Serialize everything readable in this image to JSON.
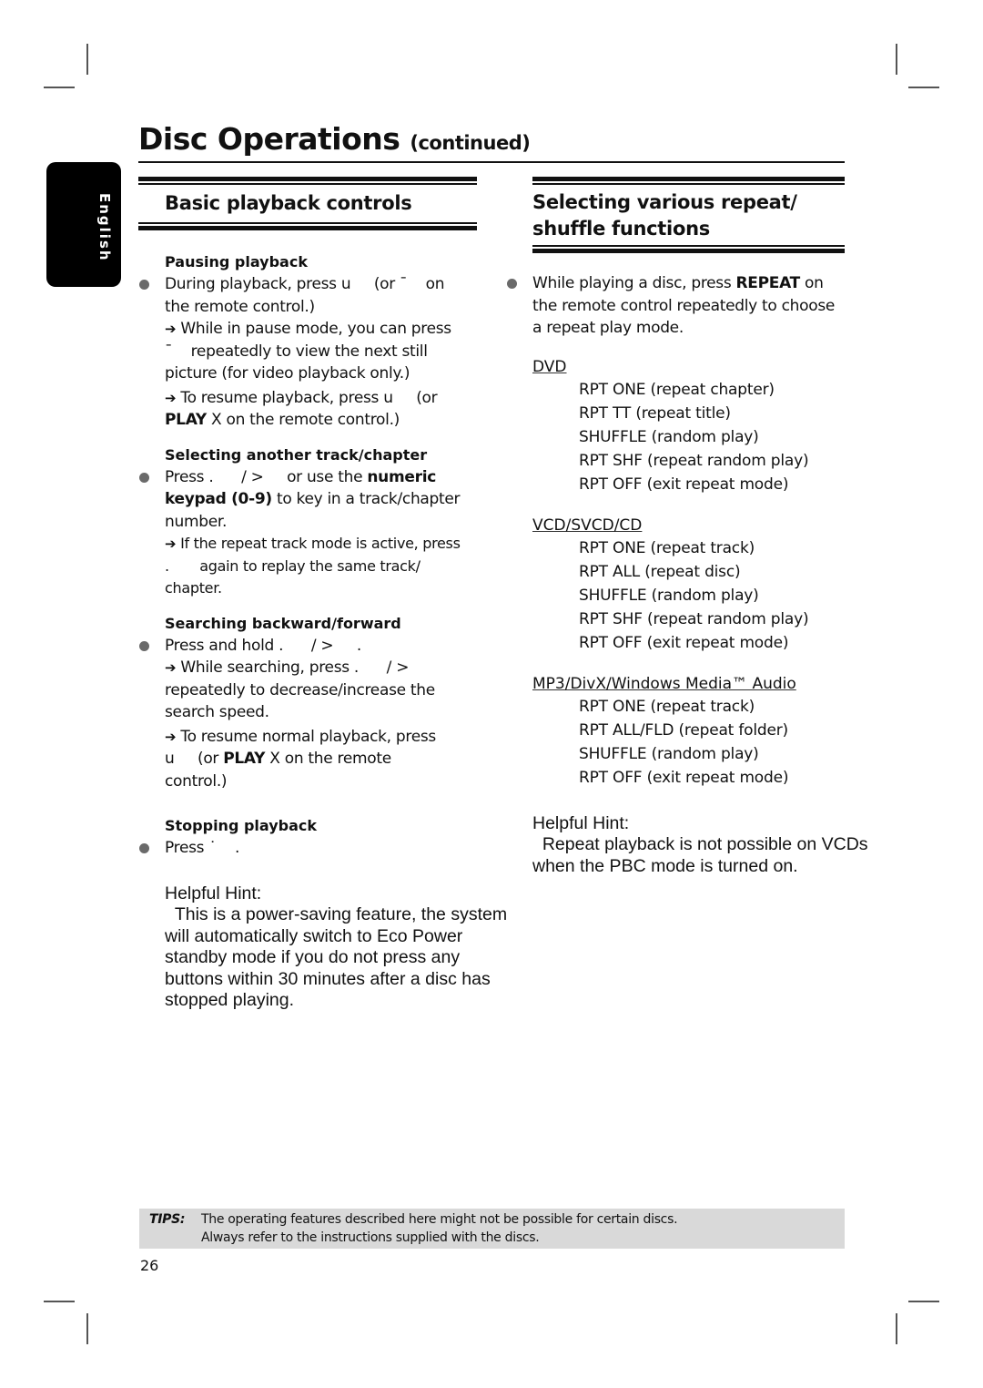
{
  "header": {
    "title": "Disc Operations",
    "title_suffix": "(continued)"
  },
  "language_tab": "English",
  "left": {
    "heading": "Basic playback controls",
    "pausing": {
      "title": "Pausing playback",
      "line1": "During playback, press u     (or ¯    on",
      "line2": "the remote control.)",
      "arrow1_a": "While in pause mode, you can press",
      "arrow1_b": "¯    repeatedly to view the next still",
      "arrow1_c": "picture (for video playback only.)",
      "arrow2_a": "To resume playback, press u     (or",
      "arrow2_b_bold": "PLAY",
      "arrow2_b": " X on the remote control.)"
    },
    "selecting": {
      "title": "Selecting another track/chapter",
      "line1_a": "Press .      / >     or use the ",
      "line1_bold": "numeric",
      "line2_bold": "keypad (0-9)",
      "line2": " to key in a track/chapter",
      "line3": "number.",
      "arrow_a": "If the repeat track mode is active, press",
      "arrow_b": ".       again to replay the same track/",
      "arrow_c": "chapter."
    },
    "searching": {
      "title": "Searching backward/forward",
      "line1": "Press and hold .      / >     .",
      "arrow1_a": "While searching, press .      / >",
      "arrow1_b": "repeatedly to decrease/increase the",
      "arrow1_c": "search speed.",
      "arrow2_a": "To resume normal playback, press",
      "arrow2_b1": "u     (or ",
      "arrow2_b_bold": "PLAY",
      "arrow2_b2": " X on the remote",
      "arrow2_c": "control.)"
    },
    "stopping": {
      "title": "Stopping playback",
      "line1": "Press ˙    ."
    },
    "hint": {
      "title": "Helpful Hint:",
      "lines": [
        "  This is a power-saving feature, the system",
        "will automatically switch to Eco Power",
        "standby mode if you do not press any",
        "buttons within 30 minutes after a disc has",
        "stopped playing."
      ]
    }
  },
  "right": {
    "heading_line1": "Selecting various repeat/",
    "heading_line2": "shuffle functions",
    "intro_a": "While playing a disc, press ",
    "intro_bold": "REPEAT",
    "intro_b": " on",
    "intro_line2": "the remote control repeatedly to choose",
    "intro_line3": "a repeat play mode.",
    "groups": [
      {
        "label": "DVD",
        "items": [
          "RPT ONE (repeat chapter)",
          "RPT TT (repeat title)",
          "SHUFFLE (random play)",
          "RPT SHF (repeat random play)",
          "RPT OFF (exit repeat mode)"
        ]
      },
      {
        "label": "VCD/SVCD/CD",
        "items": [
          "RPT ONE (repeat track)",
          "RPT ALL (repeat disc)",
          "SHUFFLE (random play)",
          "RPT SHF (repeat random play)",
          "RPT OFF (exit repeat mode)"
        ]
      },
      {
        "label": "MP3/DivX/Windows Media™ Audio",
        "items": [
          "RPT ONE (repeat track)",
          "RPT ALL/FLD (repeat folder)",
          "SHUFFLE (random play)",
          "RPT OFF (exit repeat mode)"
        ]
      }
    ],
    "hint": {
      "title": "Helpful Hint:",
      "lines": [
        "  Repeat playback is not possible on VCDs",
        "when the PBC mode is turned on."
      ]
    }
  },
  "tips": {
    "label": "TIPS:",
    "line1": "The operating features described here might not be possible for certain discs.",
    "line2": "Always refer to the instructions supplied with the discs."
  },
  "page_number": "26",
  "arrow_glyph": "➔"
}
